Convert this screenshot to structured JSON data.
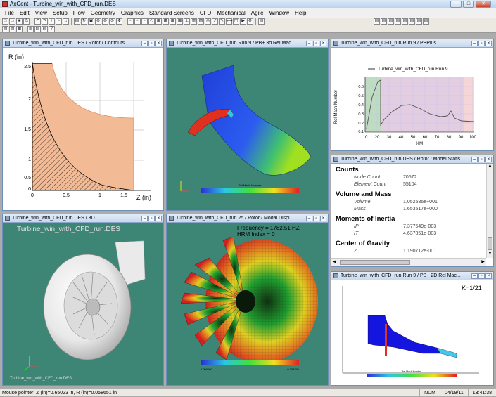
{
  "app": {
    "title": "AxCent - Turbine_win_with_CFD_run.DES"
  },
  "menu": [
    "File",
    "Edit",
    "View",
    "Setup",
    "Flow",
    "Geometry",
    "Graphics",
    "Standard Screens",
    "CFD",
    "Mechanical",
    "Agile",
    "Window",
    "Help"
  ],
  "windows": {
    "contours": {
      "title": "Turbine_win_with_CFD_run.DES / Rotor / Contours",
      "ylabel": "R (in)",
      "xlabel": "Z (in)",
      "yticks": [
        "2.5",
        "2",
        "1.5",
        "1",
        "0.5",
        "0"
      ],
      "xticks": [
        "0",
        "0.5",
        "1",
        "1.5"
      ]
    },
    "rel_mach_3d": {
      "title": "Turbine_win_with_CFD_run Run 9 / PB+ 3d Rel Mac...",
      "legend_title": "Rel Mach Number"
    },
    "pbplus": {
      "title": "Turbine_win_with_CFD_run Run 9 / PBPlus",
      "legend": "Turbine_win_with_CFD_run Run 9",
      "ylabel": "Rel Mach Number",
      "xlabel": "%M",
      "xticks": [
        "10",
        "20",
        "30",
        "40",
        "50",
        "60",
        "70",
        "80",
        "90",
        "100"
      ],
      "yticks": [
        "0.6",
        "0.5",
        "0.4",
        "0.3",
        "0.2",
        "0.1"
      ]
    },
    "model_stats": {
      "title": "Turbine_win_with_CFD_run.DES / Rotor / Model Statis...",
      "sections": [
        {
          "heading": "Counts",
          "rows": [
            {
              "k": "Node Count",
              "v": "70572"
            },
            {
              "k": "Element Count",
              "v": "55104"
            }
          ]
        },
        {
          "heading": "Volume and Mass",
          "rows": [
            {
              "k": "Volume",
              "v": "1.052586e+001"
            },
            {
              "k": "Mass",
              "v": "1.653517e+000"
            }
          ]
        },
        {
          "heading": "Moments of Inertia",
          "rows": [
            {
              "k": "IP",
              "v": "7.377549e-003"
            },
            {
              "k": "IT",
              "v": "4.637851e-003"
            }
          ]
        },
        {
          "heading": "Center of Gravity",
          "rows": [
            {
              "k": "Z",
              "v": "1.190712e-001"
            }
          ]
        }
      ]
    },
    "view3d": {
      "title": "Turbine_win_with_CFD_run.DES / 3D",
      "label": "Turbine_win_with_CFD_run.DES",
      "label_bottom": "Turbine_win_with_CFD_run.DES"
    },
    "modal": {
      "title": "Turbine_win_with_CFD_run 25 / Rotor / Modal Displ...",
      "frequency": "Frequency = 1782.51 HZ",
      "hrm": "HRM Index = 0",
      "legend_min": "0.000000",
      "legend_max": "0.333760"
    },
    "rel_mach_2d": {
      "title": "Turbine_win_with_CFD_run Run 9 / PB+ 2D Rel Mac...",
      "k": "K=1/21",
      "legend_title": "Rel Mach Number"
    }
  },
  "status": {
    "message": "Mouse pointer: Z (in)=0.65023 in, R (in)=0.058651 in",
    "num": "NUM",
    "date": "04/19/11",
    "time": "13:41:38"
  }
}
